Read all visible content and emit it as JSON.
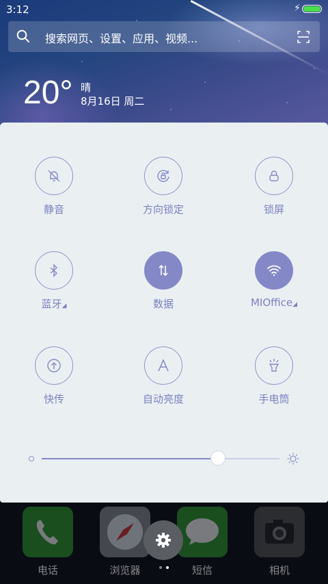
{
  "status_bar": {
    "time": "3:12",
    "battery_level": 1.0,
    "charging": true
  },
  "search": {
    "placeholder": "搜索网页、设置、应用、视频..."
  },
  "weather": {
    "temperature": "20°",
    "condition": "晴",
    "date": "8月16日 周二"
  },
  "quick_settings": {
    "tiles": [
      {
        "id": "mute",
        "label": "静音",
        "icon": "bell-off-icon",
        "active": false,
        "expandable": false
      },
      {
        "id": "rotation-lock",
        "label": "方向锁定",
        "icon": "rotation-lock-icon",
        "active": false,
        "expandable": false
      },
      {
        "id": "lock-screen",
        "label": "锁屏",
        "icon": "lock-icon",
        "active": false,
        "expandable": false
      },
      {
        "id": "bluetooth",
        "label": "蓝牙",
        "icon": "bluetooth-icon",
        "active": false,
        "expandable": true
      },
      {
        "id": "data",
        "label": "数据",
        "icon": "data-arrows-icon",
        "active": true,
        "expandable": false
      },
      {
        "id": "wifi",
        "label": "MIOffice",
        "icon": "wifi-icon",
        "active": true,
        "expandable": true
      },
      {
        "id": "transfer",
        "label": "快传",
        "icon": "upload-icon",
        "active": false,
        "expandable": false
      },
      {
        "id": "auto-brightness",
        "label": "自动亮度",
        "icon": "auto-brightness-icon",
        "active": false,
        "expandable": false
      },
      {
        "id": "flashlight",
        "label": "手电筒",
        "icon": "flashlight-icon",
        "active": false,
        "expandable": false
      }
    ],
    "brightness": 0.74
  },
  "dock": {
    "apps": [
      {
        "label": "电话",
        "icon": "phone-icon",
        "color": "#2e9e2e"
      },
      {
        "label": "浏览器",
        "icon": "compass-icon",
        "color": "#8a8f96"
      },
      {
        "label": "短信",
        "icon": "message-icon",
        "color": "#2e9e2e"
      },
      {
        "label": "相机",
        "icon": "camera-icon",
        "color": "#555555"
      }
    ]
  },
  "colors": {
    "accent": "#8488c7",
    "panel_bg": "#eaf0f2"
  }
}
